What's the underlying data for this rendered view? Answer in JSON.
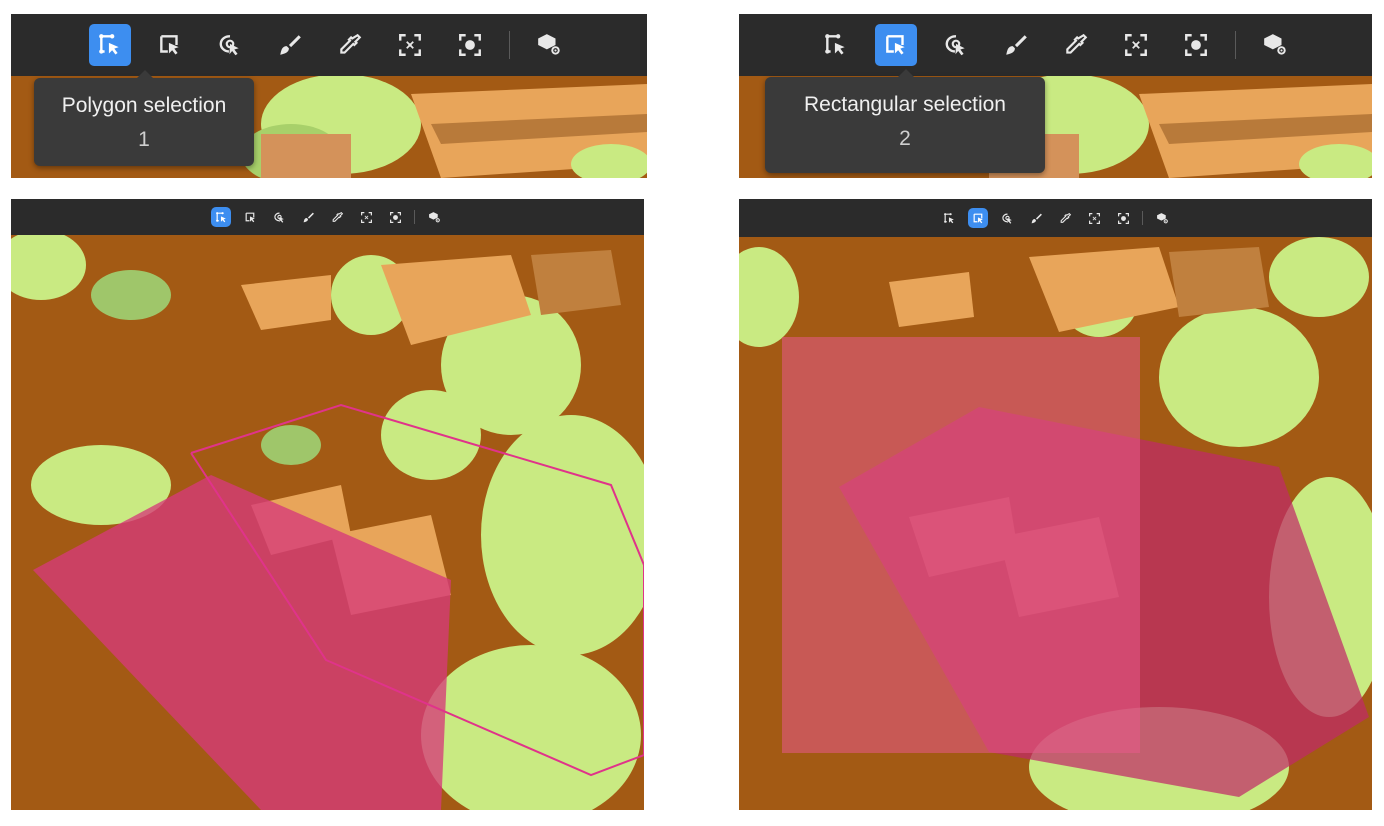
{
  "tools": [
    {
      "name": "polygon-selection",
      "icon": "polygon-select-icon"
    },
    {
      "name": "rectangular-selection",
      "icon": "rect-select-icon"
    },
    {
      "name": "lasso-selection",
      "icon": "lasso-select-icon"
    },
    {
      "name": "brush",
      "icon": "brush-icon"
    },
    {
      "name": "eyedropper",
      "icon": "eyedropper-icon"
    },
    {
      "name": "focus-expand",
      "icon": "focus-expand-icon"
    },
    {
      "name": "focus-center",
      "icon": "focus-center-icon"
    },
    {
      "name": "settings",
      "icon": "cube-settings-icon"
    }
  ],
  "panels": {
    "top_left": {
      "active_tool": "polygon-selection",
      "tooltip": {
        "title": "Polygon selection",
        "shortcut": "1"
      }
    },
    "top_right": {
      "active_tool": "rectangular-selection",
      "tooltip": {
        "title": "Rectangular selection",
        "shortcut": "2"
      }
    },
    "bottom_left": {
      "active_tool": "polygon-selection"
    },
    "bottom_right": {
      "active_tool": "rectangular-selection"
    }
  },
  "colors": {
    "ground": "#a35a14",
    "trees": "#c9ea82",
    "roofs": "#e8a55a",
    "selection_fill": "#d63a7a",
    "accent": "#3d8ef0",
    "toolbar": "#2b2b2b"
  }
}
